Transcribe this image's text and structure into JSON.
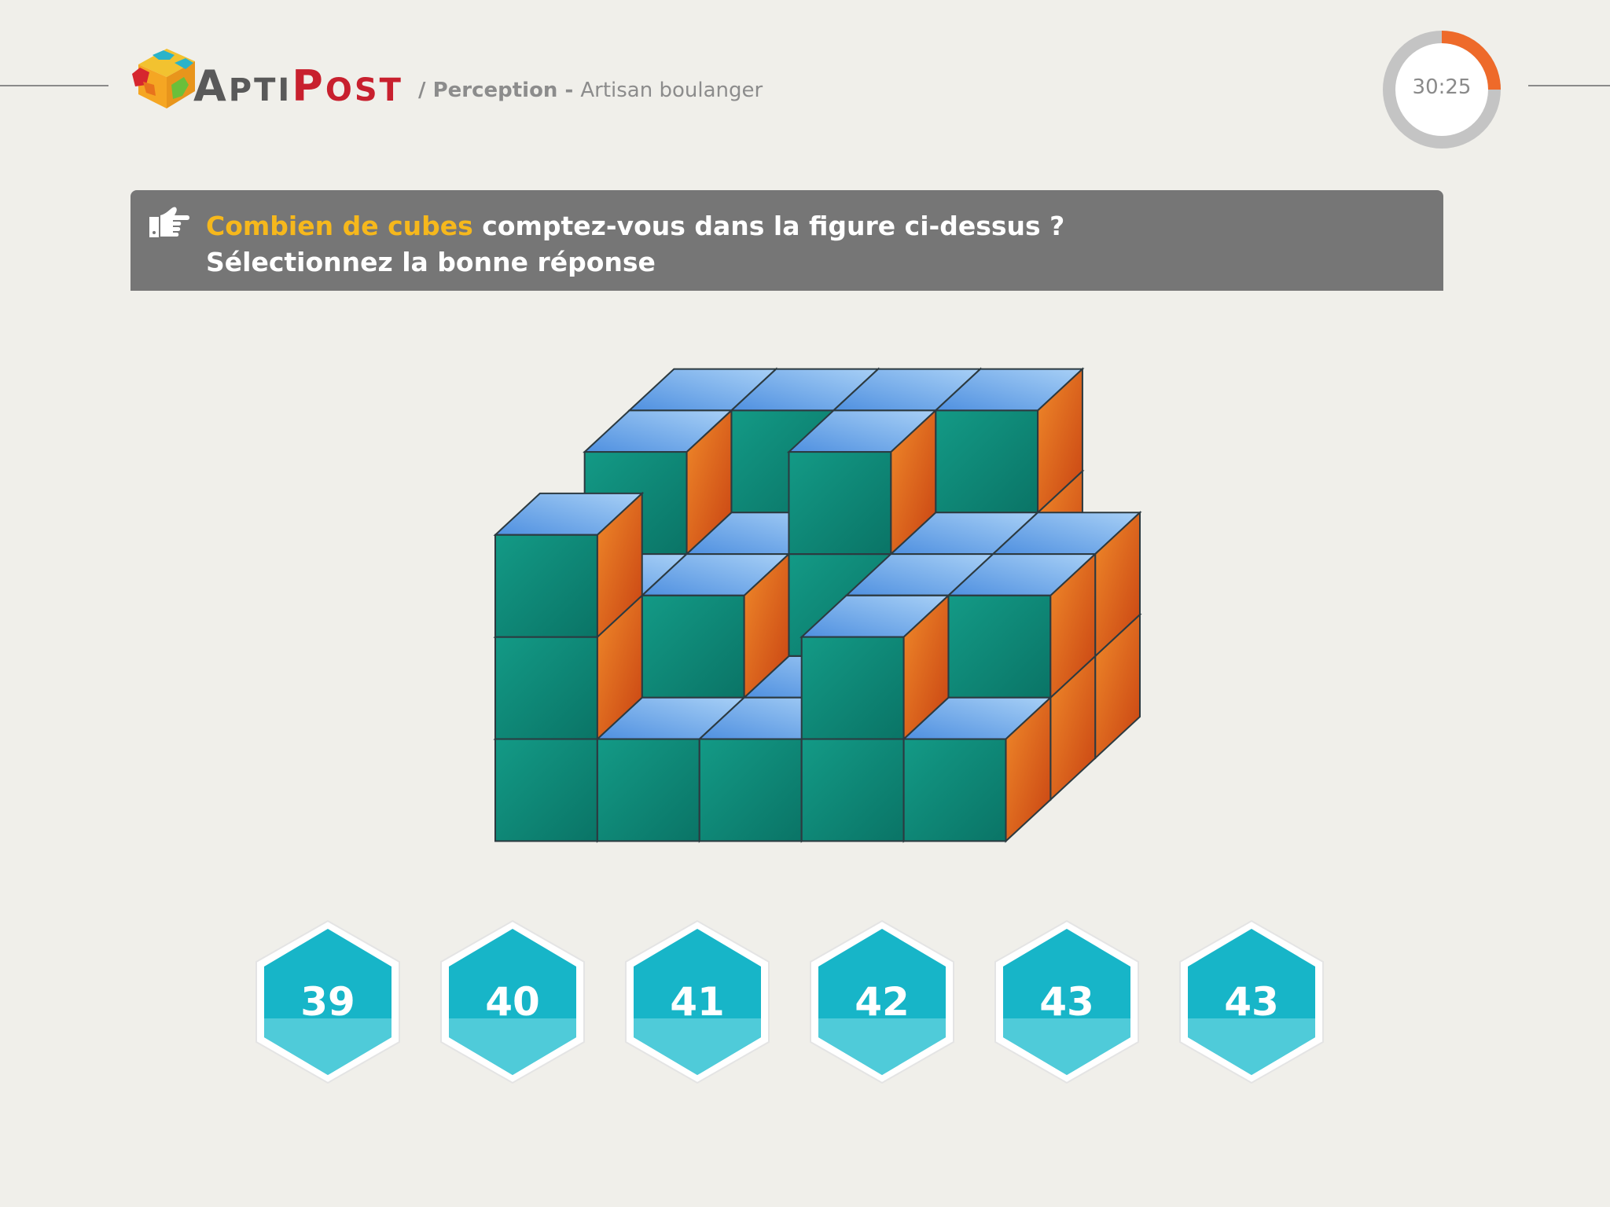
{
  "header": {
    "brand_first_letter": "A",
    "brand_part1": "PTI",
    "brand_second_letter": "P",
    "brand_part2": "OST",
    "breadcrumb_separator": "/ ",
    "breadcrumb_section": "Perception",
    "breadcrumb_dash": " - ",
    "breadcrumb_job": "Artisan boulanger",
    "timer": "30:25",
    "timer_progress": 0.25
  },
  "question": {
    "highlight": "Combien de cubes",
    "text": " comptez-vous dans la figure ci-dessus ?",
    "instruction": "Sélectionnez la bonne réponse",
    "icon": "pointing-hand-icon"
  },
  "answers": [
    "39",
    "40",
    "41",
    "42",
    "43",
    "43"
  ],
  "colors": {
    "background": "#f0efea",
    "banner": "#767676",
    "highlight": "#f6b81c",
    "brand_red": "#c8202e",
    "timer_accent": "#ee6a2a",
    "cube_top": "#6aa9e8",
    "cube_front": "#10907e",
    "cube_side": "#e0661e",
    "answer_fill": "#17b5c8"
  }
}
